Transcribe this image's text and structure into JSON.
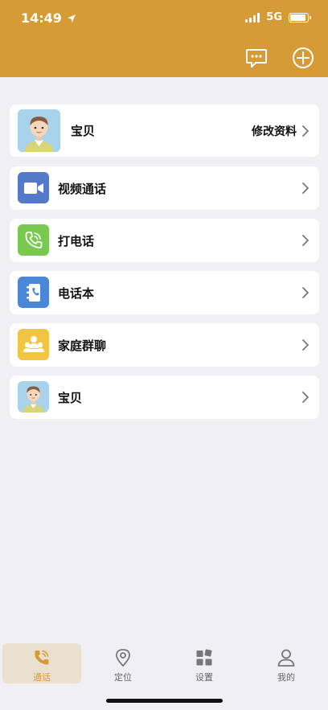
{
  "status_bar": {
    "time": "14:49",
    "network": "5G",
    "battery_level": 0.9
  },
  "header": {
    "icons": [
      "chat-bubble-icon",
      "plus-circle-icon"
    ]
  },
  "profile": {
    "name": "宝贝",
    "action": "修改资料"
  },
  "menu": [
    {
      "label": "视频通话",
      "icon": "video-camera-icon",
      "color": "#5479c9"
    },
    {
      "label": "打电话",
      "icon": "phone-icon",
      "color": "#79c84f"
    },
    {
      "label": "电话本",
      "icon": "contacts-book-icon",
      "color": "#4a88d6"
    },
    {
      "label": "家庭群聊",
      "icon": "family-group-icon",
      "color": "#f2c443"
    },
    {
      "label": "宝贝",
      "icon": "child-avatar-icon",
      "color": "#a9d3ea"
    }
  ],
  "tabbar": [
    {
      "label": "通话",
      "icon": "phone-call-icon",
      "active": true
    },
    {
      "label": "定位",
      "icon": "location-pin-icon",
      "active": false
    },
    {
      "label": "设置",
      "icon": "settings-grid-icon",
      "active": false
    },
    {
      "label": "我的",
      "icon": "person-icon",
      "active": false
    }
  ],
  "colors": {
    "header": "#d69a37",
    "background": "#efeff4",
    "active_tab": "#d69a37"
  }
}
